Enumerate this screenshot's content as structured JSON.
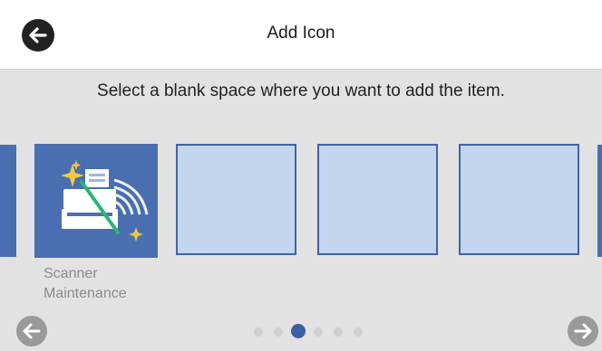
{
  "header": {
    "title": "Add Icon",
    "back_icon": "arrow-left-icon"
  },
  "instruction": "Select a blank space where you want to add the item.",
  "tiles": [
    {
      "type": "app",
      "label_line1": "Scanner",
      "label_line2": "Maintenance",
      "icon": "scanner-maintenance-icon"
    },
    {
      "type": "blank"
    },
    {
      "type": "blank"
    },
    {
      "type": "blank"
    }
  ],
  "pagination": {
    "total": 6,
    "current": 3
  },
  "nav": {
    "prev_icon": "arrow-left-icon",
    "next_icon": "arrow-right-icon"
  },
  "colors": {
    "accent": "#3e5fa4",
    "tile_fill": "#4a6fb0",
    "blank_tile_fill": "#c4d6ee",
    "background": "#e2e2e2"
  }
}
